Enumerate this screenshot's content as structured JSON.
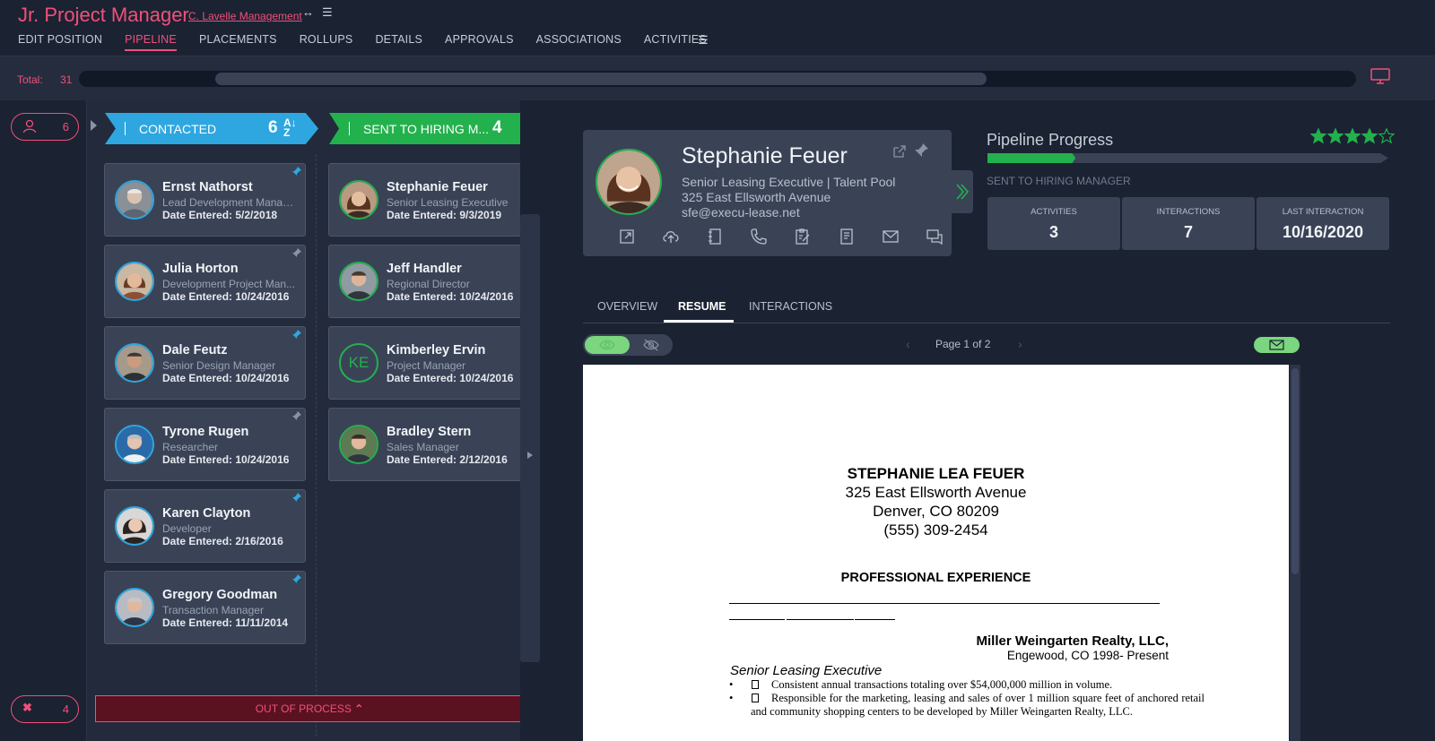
{
  "header": {
    "title": "Jr. Project Manager",
    "company": "C. Lavelle Management",
    "tabs": [
      "EDIT POSITION",
      "PIPELINE",
      "PLACEMENTS",
      "ROLLUPS",
      "DETAILS",
      "APPROVALS",
      "ASSOCIATIONS",
      "ACTIVITIES"
    ],
    "active_tab": "PIPELINE"
  },
  "totalbar": {
    "label": "Total:",
    "count": "31"
  },
  "rail": {
    "active_count": "6",
    "removed_count": "4"
  },
  "board": {
    "columns": [
      {
        "label": "CONTACTED",
        "count": "6",
        "color": "#2ea7e0"
      },
      {
        "label": "SENT TO HIRING M...",
        "count": "4",
        "color": "#23b14d"
      }
    ],
    "contacted": [
      {
        "name": "Ernst Nathorst",
        "role": "Lead Development Manag...",
        "date": "Date Entered: 5/2/2018"
      },
      {
        "name": "Julia Horton",
        "role": "Development Project Man...",
        "date": "Date Entered: 10/24/2016"
      },
      {
        "name": "Dale Feutz",
        "role": "Senior Design Manager",
        "date": "Date Entered: 10/24/2016"
      },
      {
        "name": "Tyrone Rugen",
        "role": "Researcher",
        "date": "Date Entered: 10/24/2016"
      },
      {
        "name": "Karen Clayton",
        "role": "Developer",
        "date": "Date Entered: 2/16/2016"
      },
      {
        "name": "Gregory Goodman",
        "role": "Transaction Manager",
        "date": "Date Entered: 11/11/2014"
      }
    ],
    "sent": [
      {
        "name": "Stephanie Feuer",
        "role": "Senior Leasing Executive",
        "date": "Date Entered: 9/3/2019"
      },
      {
        "name": "Jeff Handler",
        "role": "Regional Director",
        "date": "Date Entered: 10/24/2016"
      },
      {
        "name": "Kimberley Ervin",
        "role": "Project Manager",
        "date": "Date Entered: 10/24/2016",
        "initials": "KE"
      },
      {
        "name": "Bradley Stern",
        "role": "Sales Manager",
        "date": "Date Entered: 2/12/2016"
      }
    ],
    "out_of_process": "OUT OF PROCESS"
  },
  "profile": {
    "name": "Stephanie Feuer",
    "title": "Senior Leasing Executive | Talent Pool",
    "address": "325 East Ellsworth Avenue",
    "email": "sfe@execu-lease.net"
  },
  "progress": {
    "title": "Pipeline Progress",
    "stage": "SENT TO HIRING MANAGER",
    "fill_fraction": 0.22,
    "rating": 4,
    "rating_max": 5,
    "stats": [
      {
        "label": "ACTIVITIES",
        "value": "3"
      },
      {
        "label": "INTERACTIONS",
        "value": "7"
      },
      {
        "label": "LAST INTERACTION",
        "value": "10/16/2020"
      }
    ]
  },
  "profile_tabs": [
    "OVERVIEW",
    "RESUME",
    "INTERACTIONS"
  ],
  "profile_active_tab": "RESUME",
  "viewer": {
    "page_label": "Page 1 of 2"
  },
  "resume": {
    "name": "STEPHANIE LEA FEUER",
    "address1": "325 East Ellsworth Avenue",
    "address2": "Denver, CO   80209",
    "phone": "(555) 309-2454",
    "section": "PROFESSIONAL EXPERIENCE",
    "employer": "Miller Weingarten Realty, LLC,",
    "location": "Engewood, CO          1998- Present",
    "position": "Senior Leasing Executive",
    "bullet1": "Consistent annual transactions totaling over $54,000,000 million in volume.",
    "bullet2": "Responsible for the marketing, leasing and sales of over 1 million square feet of anchored retail and community shopping centers to be developed by Miller Weingarten Realty, LLC."
  },
  "colors": {
    "accent": "#f0507a",
    "contacted": "#2ea7e0",
    "sent": "#23b14d",
    "progress": "#23b14d"
  }
}
